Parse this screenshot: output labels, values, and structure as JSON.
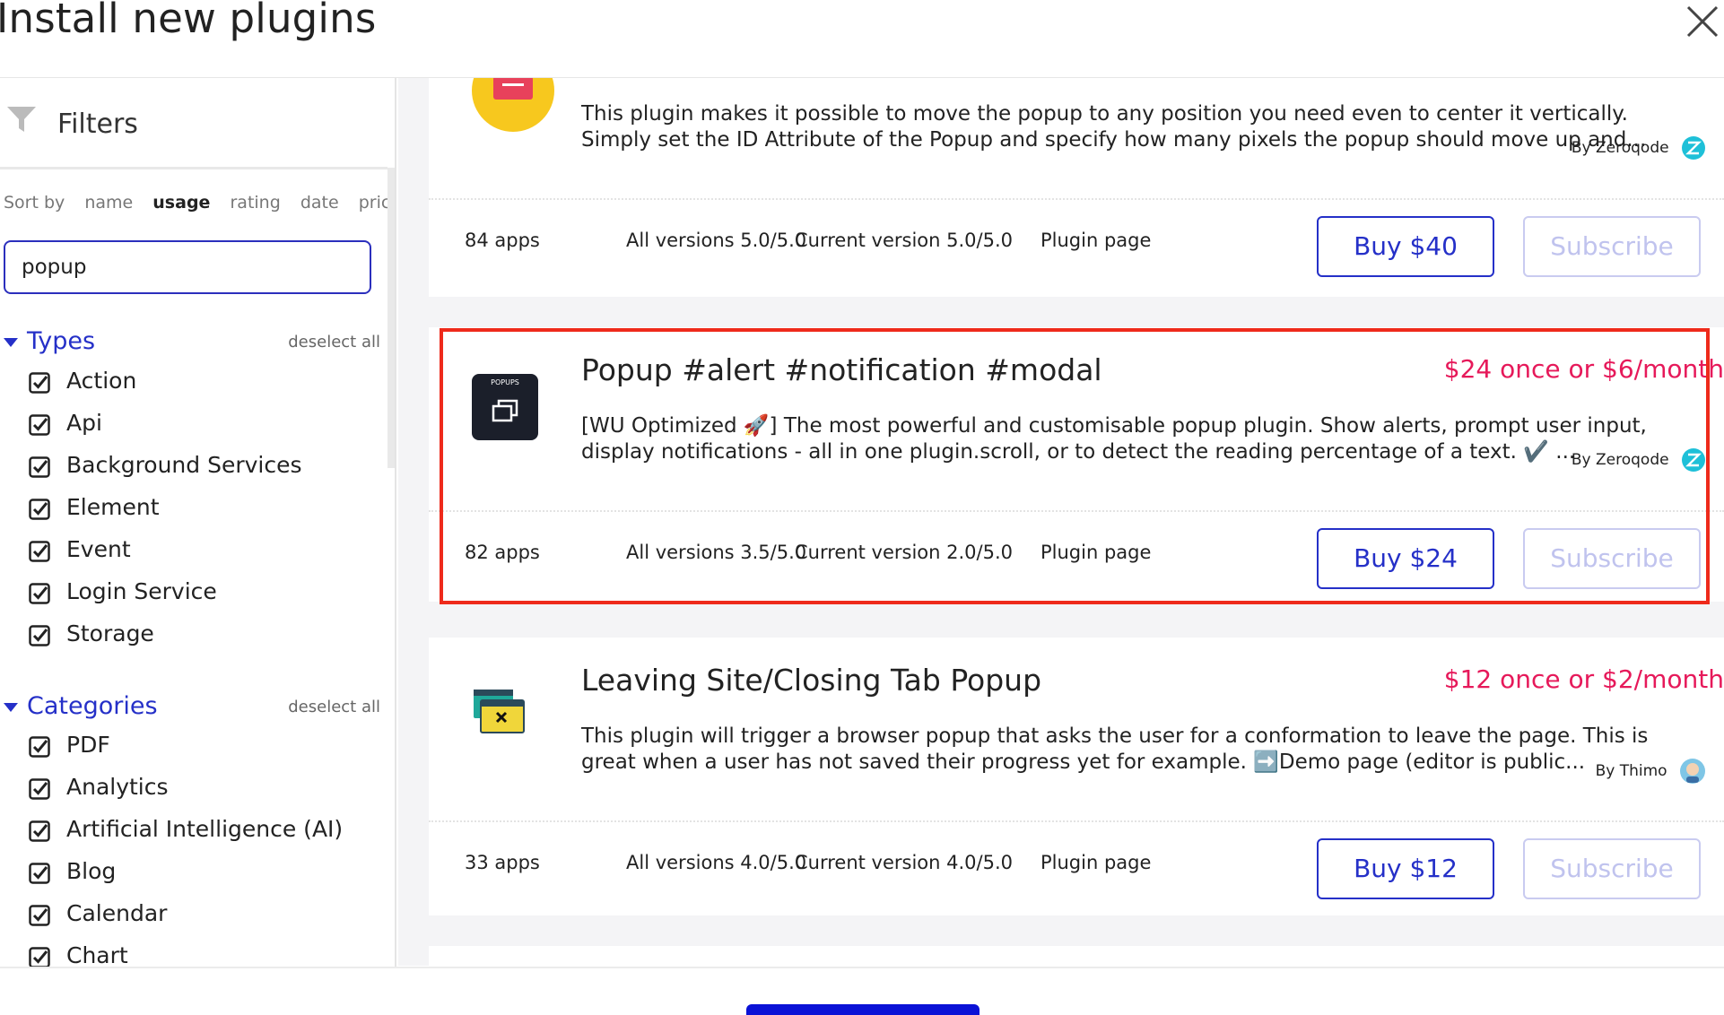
{
  "window": {
    "title": "Install new plugins"
  },
  "sidebar": {
    "filters_label": "Filters",
    "sort": {
      "label": "Sort by",
      "options": [
        "name",
        "usage",
        "rating",
        "date",
        "price"
      ],
      "selected": "usage"
    },
    "search": {
      "value": "popup",
      "placeholder": ""
    },
    "types": {
      "title": "Types",
      "deselect_label": "deselect all",
      "items": [
        "Action",
        "Api",
        "Background Services",
        "Element",
        "Event",
        "Login Service",
        "Storage"
      ]
    },
    "categories": {
      "title": "Categories",
      "deselect_label": "deselect all",
      "items": [
        "PDF",
        "Analytics",
        "Artificial Intelligence (AI)",
        "Blog",
        "Calendar",
        "Chart"
      ]
    }
  },
  "plugins": [
    {
      "name": "",
      "price": "",
      "description": "This plugin makes it possible to move the popup to any position you need even to center it vertically. Simply set the ID Attribute of the Popup and specify how many pixels the popup should move up and...",
      "author": "By Zeroqode",
      "apps": "84 apps",
      "all_versions": "All versions 5.0/5.0",
      "current_version": "Current version 5.0/5.0",
      "plugin_page": "Plugin page",
      "buy_label": "Buy $40",
      "subscribe_label": "Subscribe"
    },
    {
      "name": "Popup #alert #notification #modal",
      "price": "$24 once or $6/month",
      "description": "[WU Optimized 🚀] The most powerful and customisable popup plugin. Show alerts, prompt user input, display notifications - all in one plugin.scroll, or to detect the reading percentage of a text. ✔️ ...",
      "author": "By Zeroqode",
      "icon_text": "POPUPS",
      "apps": "82 apps",
      "all_versions": "All versions 3.5/5.0",
      "current_version": "Current version 2.0/5.0",
      "plugin_page": "Plugin page",
      "buy_label": "Buy $24",
      "subscribe_label": "Subscribe"
    },
    {
      "name": "Leaving Site/Closing Tab Popup",
      "price": "$12 once or $2/month",
      "description": "This plugin will trigger a browser popup that asks the user for a conformation to leave the page. This is great when a user has not saved their progress yet for example. ➡️Demo page (editor is public...",
      "author": "By Thimo",
      "apps": "33 apps",
      "all_versions": "All versions 4.0/5.0",
      "current_version": "Current version 4.0/5.0",
      "plugin_page": "Plugin page",
      "buy_label": "Buy $12",
      "subscribe_label": "Subscribe"
    }
  ],
  "colors": {
    "accent": "#2530c8",
    "price": "#e6195a",
    "highlight": "#ee2a1b",
    "primary_button": "#0b12d6"
  }
}
